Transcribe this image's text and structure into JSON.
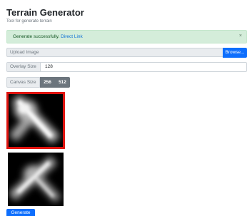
{
  "header": {
    "title": "Terrain Generator",
    "subtitle": "Tool for generate terrain"
  },
  "alert": {
    "message": "Generate successfully.",
    "link_text": "Direct Link",
    "close_glyph": "×"
  },
  "upload": {
    "label": "Upload Image",
    "browse_label": "Browse..."
  },
  "overlay": {
    "label": "Overlay Size",
    "value": "128"
  },
  "canvas": {
    "label": "Canvas Size",
    "options": [
      "256",
      "512"
    ]
  },
  "actions": {
    "generate_label": "Generate"
  },
  "colors": {
    "primary": "#0d6efd",
    "success_bg": "#d4edda",
    "selection_border": "#e0140f",
    "secondary": "#6c757d"
  }
}
